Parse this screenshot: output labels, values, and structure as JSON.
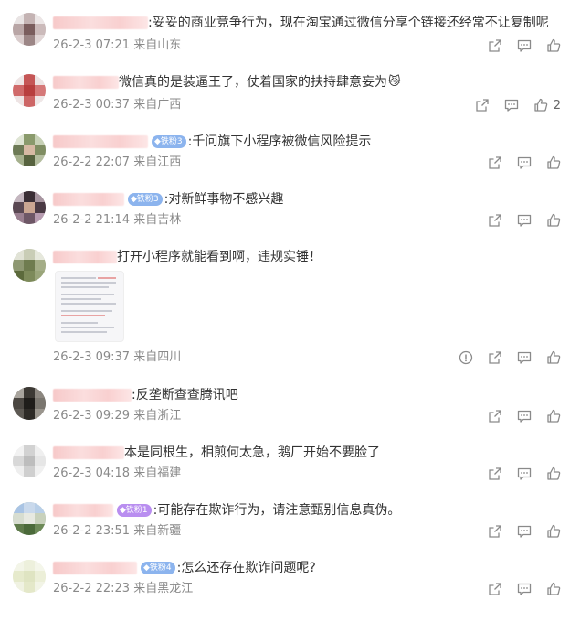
{
  "comments": [
    {
      "text": ":妥妥的商业竞争行为，现在淘宝通过微信分享个链接还经常不让复制呢",
      "date": "26-2-3 07:21",
      "location": "来自山东",
      "badge": null,
      "likes": ""
    },
    {
      "text": "微信真的是装逼王了，仗着国家的扶持肆意妄为",
      "emoji": "😼",
      "date": "26-2-3 00:37",
      "location": "来自广西",
      "badge": null,
      "likes": "2"
    },
    {
      "text": ":千问旗下小程序被微信风险提示",
      "date": "26-2-2 22:07",
      "location": "来自江西",
      "badge": "铁粉3",
      "likes": ""
    },
    {
      "text": ":对新鲜事物不感兴趣",
      "date": "26-2-2 21:14",
      "location": "来自吉林",
      "badge": "铁粉3",
      "likes": ""
    },
    {
      "text": "打开小程序就能看到啊，违规实锤！",
      "date": "26-2-3 09:37",
      "location": "来自四川",
      "badge": null,
      "likes": ""
    },
    {
      "text": ":反垄断查查腾讯吧",
      "date": "26-2-3 09:29",
      "location": "来自浙江",
      "badge": null,
      "likes": ""
    },
    {
      "text": "本是同根生，相煎何太急，鹅厂开始不要脸了",
      "date": "26-2-3 04:18",
      "location": "来自福建",
      "badge": null,
      "likes": ""
    },
    {
      "text": ":可能存在欺诈行为，请注意甄别信息真伪。",
      "date": "26-2-2 23:51",
      "location": "来自新疆",
      "badge": "铁粉1",
      "likes": ""
    },
    {
      "text": ":怎么还存在欺诈问题呢?",
      "date": "26-2-2 22:23",
      "location": "来自黑龙江",
      "badge": "铁粉4",
      "likes": ""
    }
  ],
  "colors": {
    "meta": "#8a8a8a",
    "badge_blue": "#8cb4ee",
    "badge_purple": "#b98ef0"
  },
  "icons": [
    "share-icon",
    "comment-icon",
    "like-icon",
    "report-icon"
  ]
}
